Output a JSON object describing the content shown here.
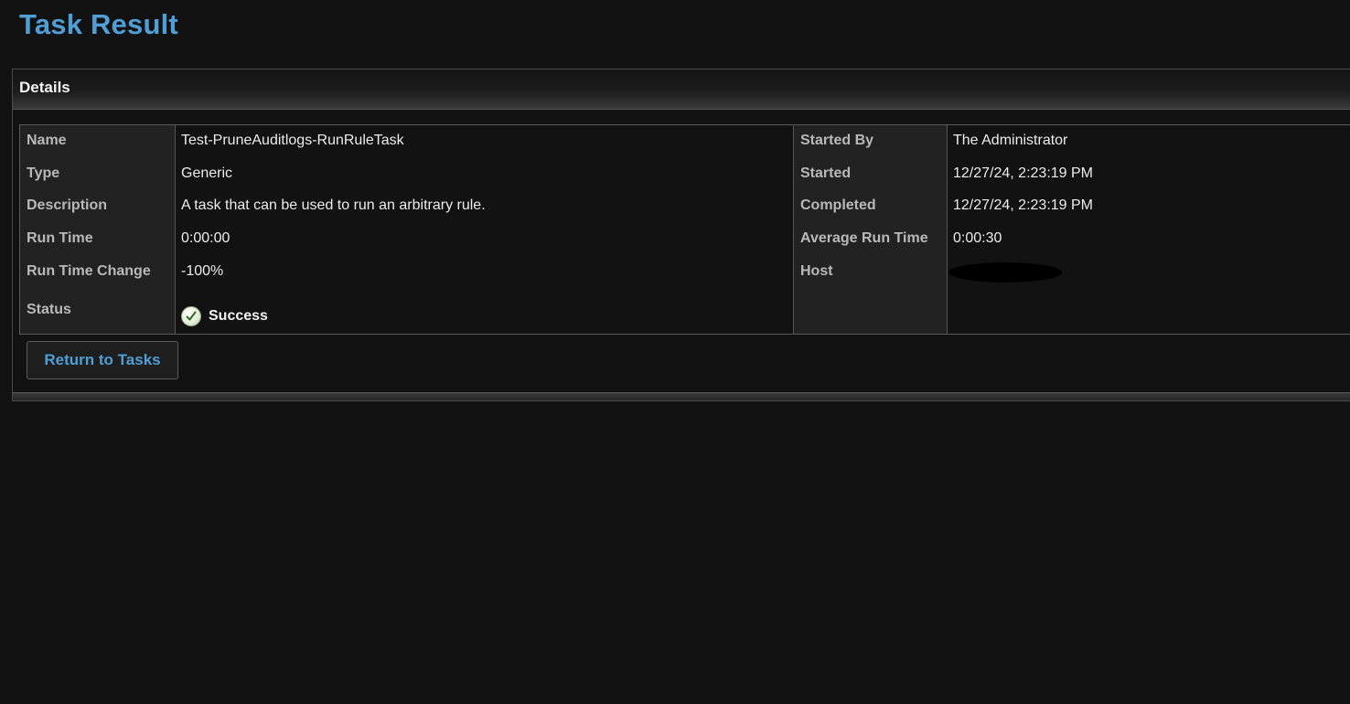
{
  "page": {
    "title": "Task Result"
  },
  "panel": {
    "title": "Details"
  },
  "left_fields": [
    {
      "label": "Name",
      "value": "Test-PruneAuditlogs-RunRuleTask"
    },
    {
      "label": "Type",
      "value": "Generic"
    },
    {
      "label": "Description",
      "value": "A task that can be used to run an arbitrary rule."
    },
    {
      "label": "Run Time",
      "value": "0:00:00"
    },
    {
      "label": "Run Time Change",
      "value": "-100%"
    },
    {
      "label": "Status",
      "value": "Success"
    }
  ],
  "right_fields": [
    {
      "label": "Started By",
      "value": "The Administrator"
    },
    {
      "label": "Started",
      "value": "12/27/24, 2:23:19 PM"
    },
    {
      "label": "Completed",
      "value": "12/27/24, 2:23:19 PM"
    },
    {
      "label": "Average Run Time",
      "value": "0:00:30"
    },
    {
      "label": "Host",
      "value": ""
    }
  ],
  "actions": {
    "return_label": "Return to Tasks"
  },
  "colors": {
    "accent": "#4f9fd6",
    "background": "#121212",
    "label_column": "#222222"
  },
  "icons": {
    "status": "check-circle-icon"
  }
}
